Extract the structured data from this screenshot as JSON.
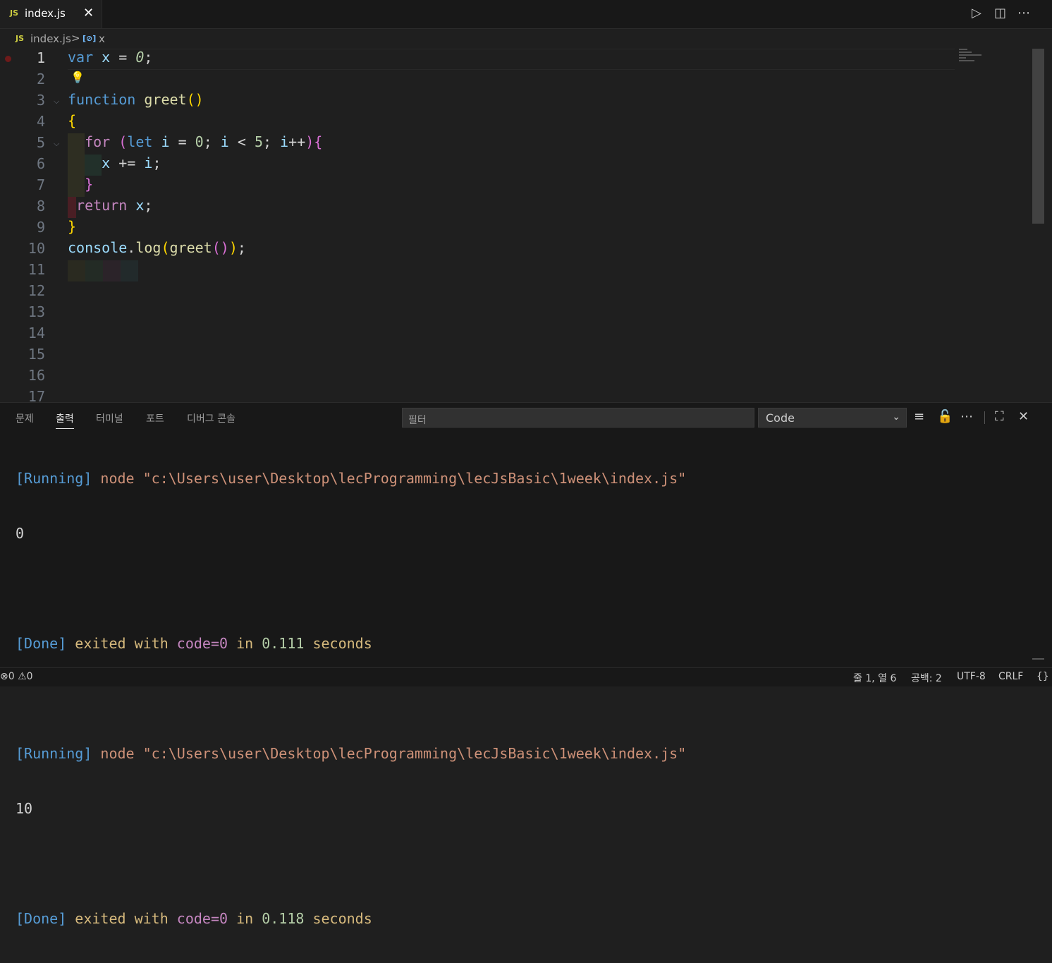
{
  "tab": {
    "lang_badge": "JS",
    "filename": "index.js",
    "close_glyph": "✕"
  },
  "toolbar": {
    "run_glyph": "▷",
    "split_glyph": "◫",
    "more_glyph": "⋯"
  },
  "breadcrumb": {
    "lang_badge": "JS",
    "file": "index.js",
    "separator": ">",
    "symbol_icon": "[⊘]",
    "symbol": "x"
  },
  "editor": {
    "line_numbers": [
      "1",
      "2",
      "3",
      "4",
      "5",
      "6",
      "7",
      "8",
      "9",
      "10",
      "11",
      "12",
      "13",
      "14",
      "15",
      "16",
      "17"
    ],
    "active_line": 1
  },
  "panel": {
    "tabs": [
      "문제",
      "출력",
      "터미널",
      "포트",
      "디버그 콘솔"
    ],
    "active_tab": "출력",
    "filter_placeholder": "필터",
    "channel": "Code",
    "output": {
      "run1_open": "[Running]",
      "run1_cmd": " node \"c:\\Users\\user\\Desktop\\lecProgramming\\lecJsBasic\\1week\\index.js\"",
      "run1_result": "0",
      "done1_label": "[Done]",
      "done1_text": " exited with ",
      "done1_code": "code=0",
      "done1_in": " in ",
      "done1_time": "0.111",
      "done1_unit": " seconds",
      "run2_open": "[Running]",
      "run2_cmd": " node \"c:\\Users\\user\\Desktop\\lecProgramming\\lecJsBasic\\1week\\index.js\"",
      "run2_result": "10",
      "done2_label": "[Done]",
      "done2_text": " exited with ",
      "done2_code": "code=0",
      "done2_in": " in ",
      "done2_time": "0.118",
      "done2_unit": " seconds"
    }
  },
  "status": {
    "errors": "0",
    "warnings": "0",
    "position": "줄 1, 열 6",
    "spaces": "공백: 2",
    "encoding": "UTF-8",
    "eol": "CRLF",
    "lang_glyph": "{}"
  },
  "colors": {
    "accent": "#569cd6",
    "background": "#1f1f1f",
    "panel": "#181818"
  }
}
